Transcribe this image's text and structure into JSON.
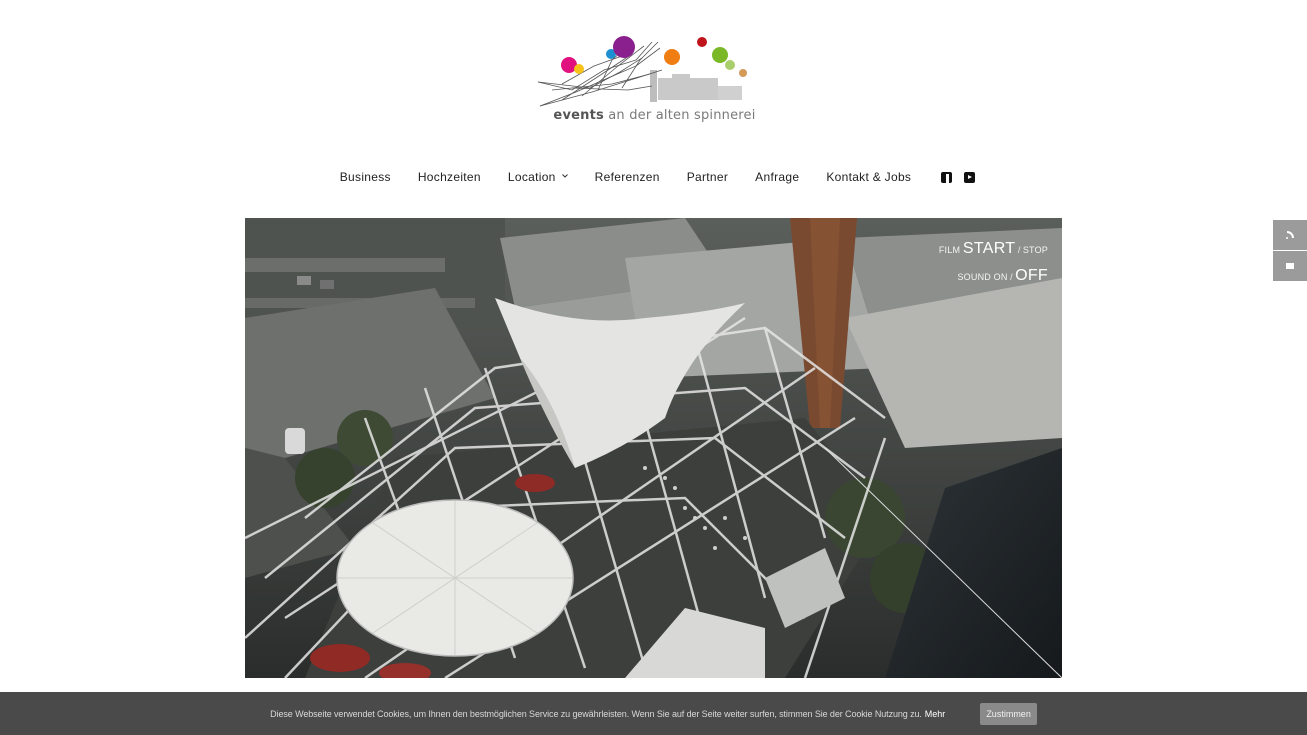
{
  "brand": {
    "bold": "events",
    "rest": " an der alten spinnerei"
  },
  "nav": {
    "items": [
      {
        "label": "Business"
      },
      {
        "label": "Hochzeiten"
      },
      {
        "label": "Location"
      },
      {
        "label": "Referenzen"
      },
      {
        "label": "Partner"
      },
      {
        "label": "Anfrage"
      },
      {
        "label": "Kontakt & Jobs"
      }
    ],
    "social": [
      "facebook-icon",
      "youtube-icon"
    ]
  },
  "video": {
    "film_small": "FILM ",
    "film_start": "START",
    "film_sep": " / ",
    "film_stop": "STOP",
    "sound_small": "SOUND ",
    "sound_on": "ON",
    "sound_sep": " / ",
    "sound_off": "OFF"
  },
  "sidebar": {
    "icons": [
      "rss-icon",
      "mail-icon"
    ]
  },
  "cookie": {
    "message": "Diese Webseite verwendet Cookies, um Ihnen den bestmöglichen Service zu gewährleisten. Wenn Sie auf der Seite weiter surfen, stimmen Sie der Cookie Nutzung zu.",
    "more": "Mehr",
    "accept": "Zustimmen"
  },
  "colors": {
    "cookie_bar": "#4a4a4a",
    "accept_button": "#8a8a8a",
    "sidebar_button": "#9b9b9b",
    "logo_magenta": "#e0117f",
    "logo_purple": "#8a1f8e",
    "logo_orange": "#f07d12",
    "logo_red": "#c0141c",
    "logo_green": "#7ab828",
    "logo_yellow": "#f7c21a",
    "logo_blue": "#1c8fd0"
  }
}
